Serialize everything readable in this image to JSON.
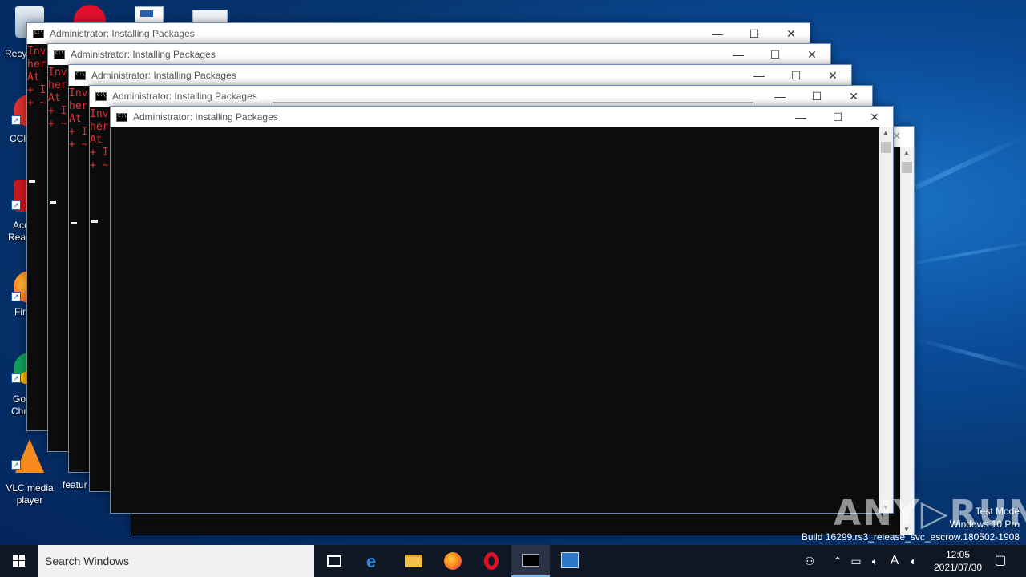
{
  "desktop": {
    "icons": [
      {
        "label": "Recycle Bin",
        "visible": "Recyc",
        "icon": "recycle-bin-icon"
      },
      {
        "label": "CCleaner",
        "visible": "CCle",
        "icon": "ccleaner-icon"
      },
      {
        "label": "Acrobat Reader",
        "visible_line1": "Acr",
        "visible_line2": "Read",
        "icon": "acrobat-icon"
      },
      {
        "label": "Firefox",
        "visible": "Fire",
        "icon": "firefox-icon"
      },
      {
        "label": "Google Chrome",
        "visible_line1": "Goo",
        "visible_line2": "Chr",
        "icon": "chrome-icon"
      },
      {
        "label_line1": "VLC media",
        "label_line2": "player",
        "icon": "vlc-icon"
      }
    ],
    "partial_icon_label": "featur"
  },
  "windows": {
    "title": "Administrator:  Installing Packages",
    "error_lines": [
      "Inv",
      "her",
      "At",
      "+ I",
      "+ ~"
    ],
    "minimize": "—",
    "maximize": "☐",
    "close": "✕"
  },
  "watermark": {
    "brand": "ANY▷RUN",
    "line1": "Test Mode",
    "line2": "Windows 10 Pro",
    "line3": "Build 16299.rs3_release_svc_escrow.180502-1908"
  },
  "taskbar": {
    "search_placeholder": "Search Windows",
    "time": "12:05",
    "date": "2021/07/30",
    "ime": "A"
  }
}
